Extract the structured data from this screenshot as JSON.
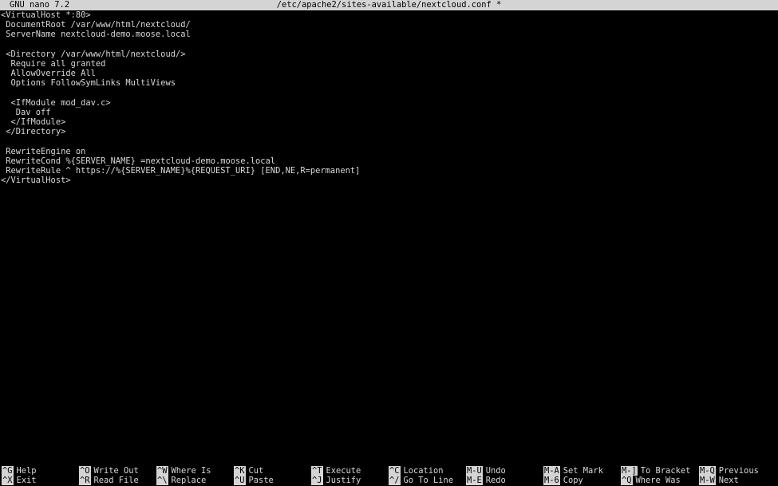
{
  "titlebar": {
    "app": "GNU nano 7.2",
    "file": "/etc/apache2/sites-available/nextcloud.conf *"
  },
  "editor": {
    "lines": [
      "<VirtualHost *:80>",
      " DocumentRoot /var/www/html/nextcloud/",
      " ServerName nextcloud-demo.moose.local",
      "",
      " <Directory /var/www/html/nextcloud/>",
      "  Require all granted",
      "  AllowOverride All",
      "  Options FollowSymLinks MultiViews",
      "",
      "  <IfModule mod_dav.c>",
      "   Dav off",
      "  </IfModule>",
      " </Directory>",
      "",
      " RewriteEngine on",
      " RewriteCond %{SERVER_NAME} =nextcloud-demo.moose.local",
      " RewriteRule ^ https://%{SERVER_NAME}%{REQUEST_URI} [END,NE,R=permanent]",
      "</VirtualHost>"
    ]
  },
  "shortcuts": {
    "row0": [
      {
        "key": "^G",
        "label": "Help"
      },
      {
        "key": "^O",
        "label": "Write Out"
      },
      {
        "key": "^W",
        "label": "Where Is"
      },
      {
        "key": "^K",
        "label": "Cut"
      },
      {
        "key": "^T",
        "label": "Execute"
      },
      {
        "key": "^C",
        "label": "Location"
      },
      {
        "key": "M-U",
        "label": "Undo"
      },
      {
        "key": "M-A",
        "label": "Set Mark"
      },
      {
        "key": "M-]",
        "label": "To Bracket"
      },
      {
        "key": "M-Q",
        "label": "Previous"
      }
    ],
    "row1": [
      {
        "key": "^X",
        "label": "Exit"
      },
      {
        "key": "^R",
        "label": "Read File"
      },
      {
        "key": "^\\",
        "label": "Replace"
      },
      {
        "key": "^U",
        "label": "Paste"
      },
      {
        "key": "^J",
        "label": "Justify"
      },
      {
        "key": "^/",
        "label": "Go To Line"
      },
      {
        "key": "M-E",
        "label": "Redo"
      },
      {
        "key": "M-6",
        "label": "Copy"
      },
      {
        "key": "^Q",
        "label": "Where Was"
      },
      {
        "key": "M-W",
        "label": "Next"
      }
    ]
  }
}
